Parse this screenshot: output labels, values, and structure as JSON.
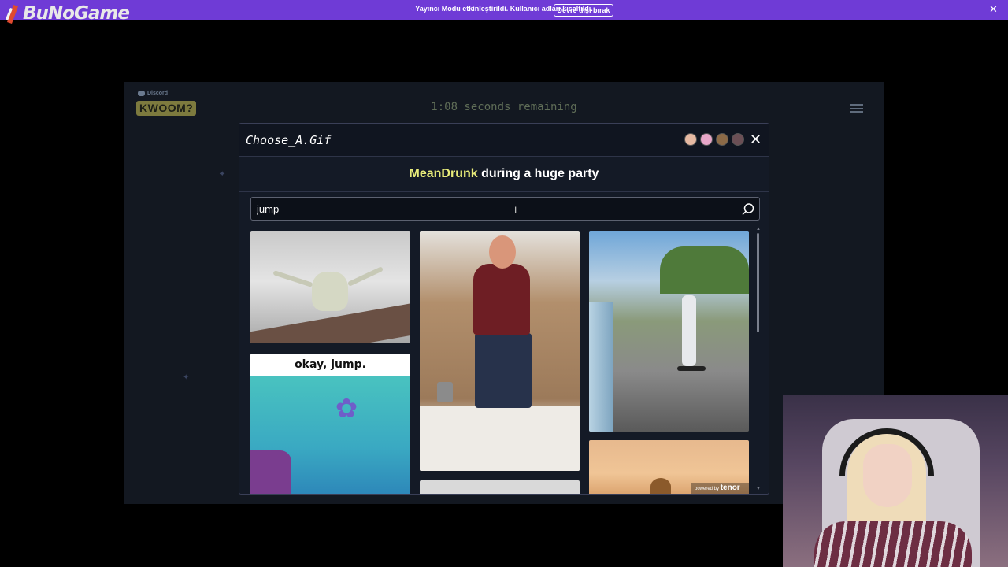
{
  "streamer_bar": {
    "message": "Yayıncı Modu etkinleştirildi. Kullanıcı adları kısaltıldı.",
    "disable_button": "Devre dışı bırak",
    "close_icon": "close-icon"
  },
  "overlay": {
    "logo_text": "BuNoGame",
    "logo_color": "#e04a2f"
  },
  "game": {
    "discord_label": "Discord",
    "app_logo": "KWOOM?",
    "timer_text": "1:08 seconds remaining",
    "menu_icon": "hamburger-icon"
  },
  "modal": {
    "title": "Choose_A.Gif",
    "players": [
      "player-avatar-1",
      "player-avatar-2",
      "player-avatar-3",
      "player-avatar-4"
    ],
    "prompt_name": "MeanDrunk",
    "prompt_rest": " during a huge party",
    "search": {
      "value": "jump",
      "placeholder": ""
    },
    "gifs": [
      {
        "id": "gif-frog-jump"
      },
      {
        "id": "gif-man-bed-jump"
      },
      {
        "id": "gif-hoverboard-bridge"
      },
      {
        "id": "gif-okay-jump",
        "caption": "okay, jump."
      },
      {
        "id": "gif-partial-bottom"
      },
      {
        "id": "gif-cartoon-sky"
      }
    ],
    "attribution_prefix": "powered by",
    "attribution_brand": "tenor"
  },
  "colors": {
    "streamer_bar": "#6f3bd6",
    "prompt_highlight": "#e8ec7a",
    "modal_bg": "#141a26"
  }
}
